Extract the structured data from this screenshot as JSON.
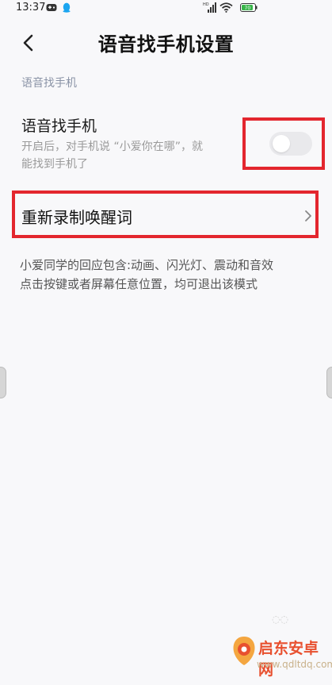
{
  "status_bar": {
    "time": "13:37",
    "signal_tag": "HD",
    "battery_level": "70"
  },
  "header": {
    "title": "语音找手机设置"
  },
  "section": {
    "header": "语音找手机"
  },
  "voice_find": {
    "title": "语音找手机",
    "description_line1": "开启后，对手机说 “小爱你在哪”，就",
    "description_line2": "能找到手机了",
    "toggle_on": false
  },
  "rerecord": {
    "label": "重新录制唤醒词"
  },
  "footnote": {
    "line1": "小爱同学的回应包含:动画、闪光灯、震动和音效",
    "line2": "点击按键或者屏幕任意位置，均可退出该模式"
  },
  "watermark": {
    "brand": "启东安卓网",
    "url": "www.qdltdq.com"
  },
  "colors": {
    "highlight_box": "#e3262e",
    "background": "#f8f8fa",
    "section_header": "#8a93a6",
    "toggle_off": "#e9e9ec"
  }
}
